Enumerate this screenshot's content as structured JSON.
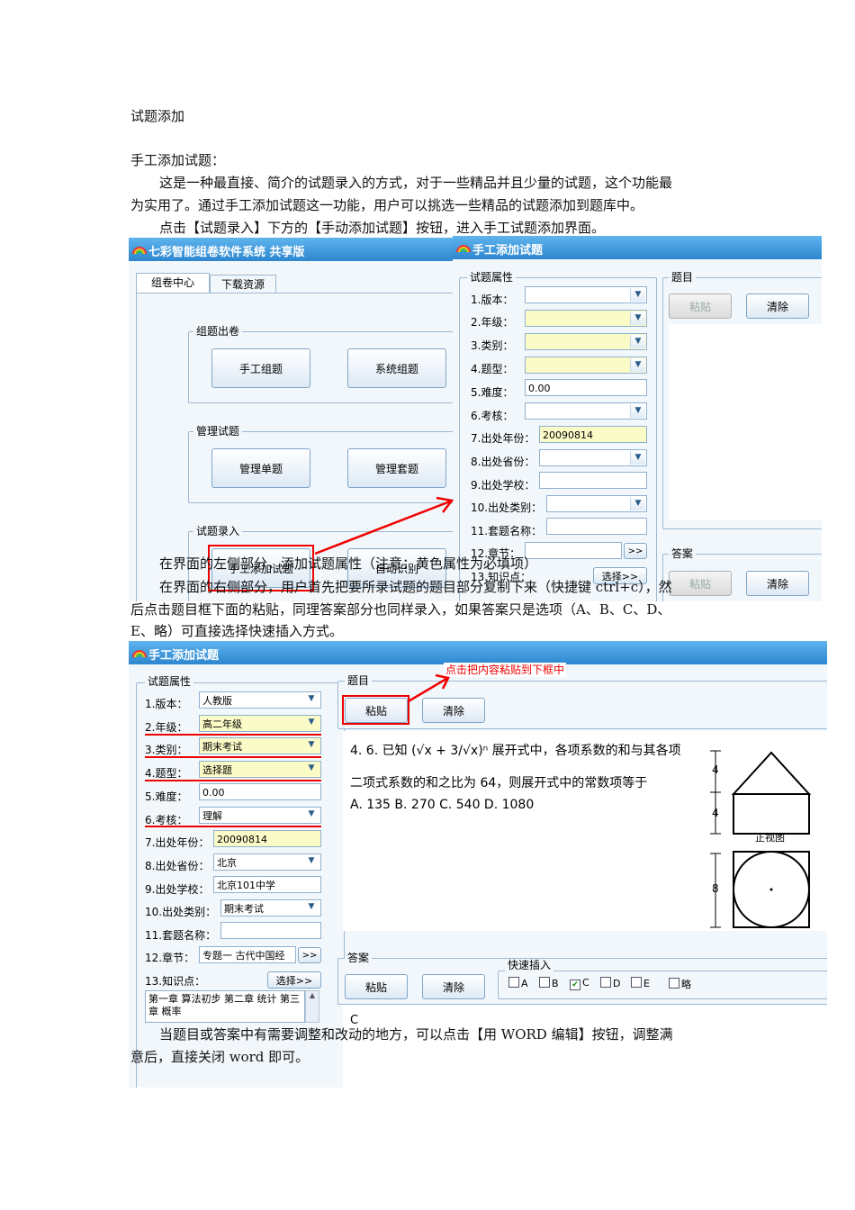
{
  "doc": {
    "title": "试题添加",
    "subtitle": "手工添加试题：",
    "para1a": "这是一种最直接、简介的试题录入的方式，对于一些精品并且少量的试题，这个功能最",
    "para1b": "为实用了。通过手工添加试题这一功能，用户可以挑选一些精品的试题添加到题库中。",
    "para2": "点击【试题录入】下方的【手动添加试题】按钮，进入手工试题添加界面。",
    "para3": "在界面的左侧部分，添加试题属性（注意：黄色属性为必填项）",
    "para4a": "在界面的右侧部分，用户首先把要所录试题的题目部分复制下来（快捷键 ctrl+c），然",
    "para4b": "后点击题目框下面的粘贴，同理答案部分也同样录入，如果答案只是选项（A、B、C、D、",
    "para4c": "E、略）可直接选择快速插入方式。",
    "para5a": "当题目或答案中有需要调整和改动的地方，可以点击【用 WORD 编辑】按钮，调整满",
    "para5b": "意后，直接关闭 word 即可。"
  },
  "main_window": {
    "title": "七彩智能组卷软件系统 共享版",
    "tabs": [
      "组卷中心",
      "下载资源"
    ],
    "group1": "组题出卷",
    "btn_manual_compose": "手工组题",
    "btn_system_compose": "系统组题",
    "group2": "管理试题",
    "btn_manage_single": "管理单题",
    "btn_manage_set": "管理套题",
    "group3": "试题录入",
    "btn_manual_add": "手工添加试题",
    "btn_auto_identify": "自动识别"
  },
  "add_window1": {
    "title": "手工添加试题",
    "attr_group": "试题属性",
    "fields": [
      {
        "label": "1.版本：",
        "value": ""
      },
      {
        "label": "2.年级：",
        "value": ""
      },
      {
        "label": "3.类别：",
        "value": ""
      },
      {
        "label": "4.题型：",
        "value": ""
      },
      {
        "label": "5.难度：",
        "value": "0.00"
      },
      {
        "label": "6.考核：",
        "value": ""
      },
      {
        "label": "7.出处年份：",
        "value": "20090814"
      },
      {
        "label": "8.出处省份：",
        "value": ""
      },
      {
        "label": "9.出处学校：",
        "value": ""
      },
      {
        "label": "10.出处类别：",
        "value": ""
      },
      {
        "label": "11.套题名称：",
        "value": ""
      },
      {
        "label": "12.章节：",
        "value": ""
      },
      {
        "label": "13.知识点：",
        "value": ""
      }
    ],
    "chapter_btn": ">>",
    "select_btn": "选择>>",
    "question_group": "题目",
    "answer_group": "答案",
    "paste": "粘贴",
    "clear": "清除"
  },
  "add_window2": {
    "title": "手工添加试题",
    "attr_group": "试题属性",
    "fields": [
      {
        "label": "1.版本：",
        "value": "人教版"
      },
      {
        "label": "2.年级：",
        "value": "高二年级"
      },
      {
        "label": "3.类别：",
        "value": "期末考试"
      },
      {
        "label": "4.题型：",
        "value": "选择题"
      },
      {
        "label": "5.难度：",
        "value": "0.00"
      },
      {
        "label": "6.考核：",
        "value": "理解"
      },
      {
        "label": "7.出处年份：",
        "value": "20090814"
      },
      {
        "label": "8.出处省份：",
        "value": "北京"
      },
      {
        "label": "9.出处学校：",
        "value": "北京101中学"
      },
      {
        "label": "10.出处类别：",
        "value": "期末考试"
      },
      {
        "label": "11.套题名称：",
        "value": ""
      },
      {
        "label": "12.章节：",
        "value": "专题一 古代中国经"
      },
      {
        "label": "13.知识点：",
        "value": ""
      }
    ],
    "chapter_btn": ">>",
    "select_btn": "选择>>",
    "knowledge": "第一章 算法初步  第二章 统计  第三章 概率",
    "question_group": "题目",
    "annotation": "点击把内容粘贴到下框中",
    "paste": "粘贴",
    "clear": "清除",
    "question_line1": "4. 6. 已知 (√x + 3/√x)ⁿ 展开式中，各项系数的和与其各项",
    "question_line2": "二项式系数的和之比为 64，则展开式中的常数项等于",
    "question_opts": "A. 135      B. 270      C. 540      D. 1080",
    "figure_caption": "正视图",
    "dim_top": "4",
    "dim_mid": "4",
    "dim_bottom": "8",
    "answer_group": "答案",
    "quick_insert": "快速插入",
    "options": [
      "A",
      "B",
      "C",
      "D",
      "E",
      "略"
    ],
    "answer_value": "C"
  }
}
